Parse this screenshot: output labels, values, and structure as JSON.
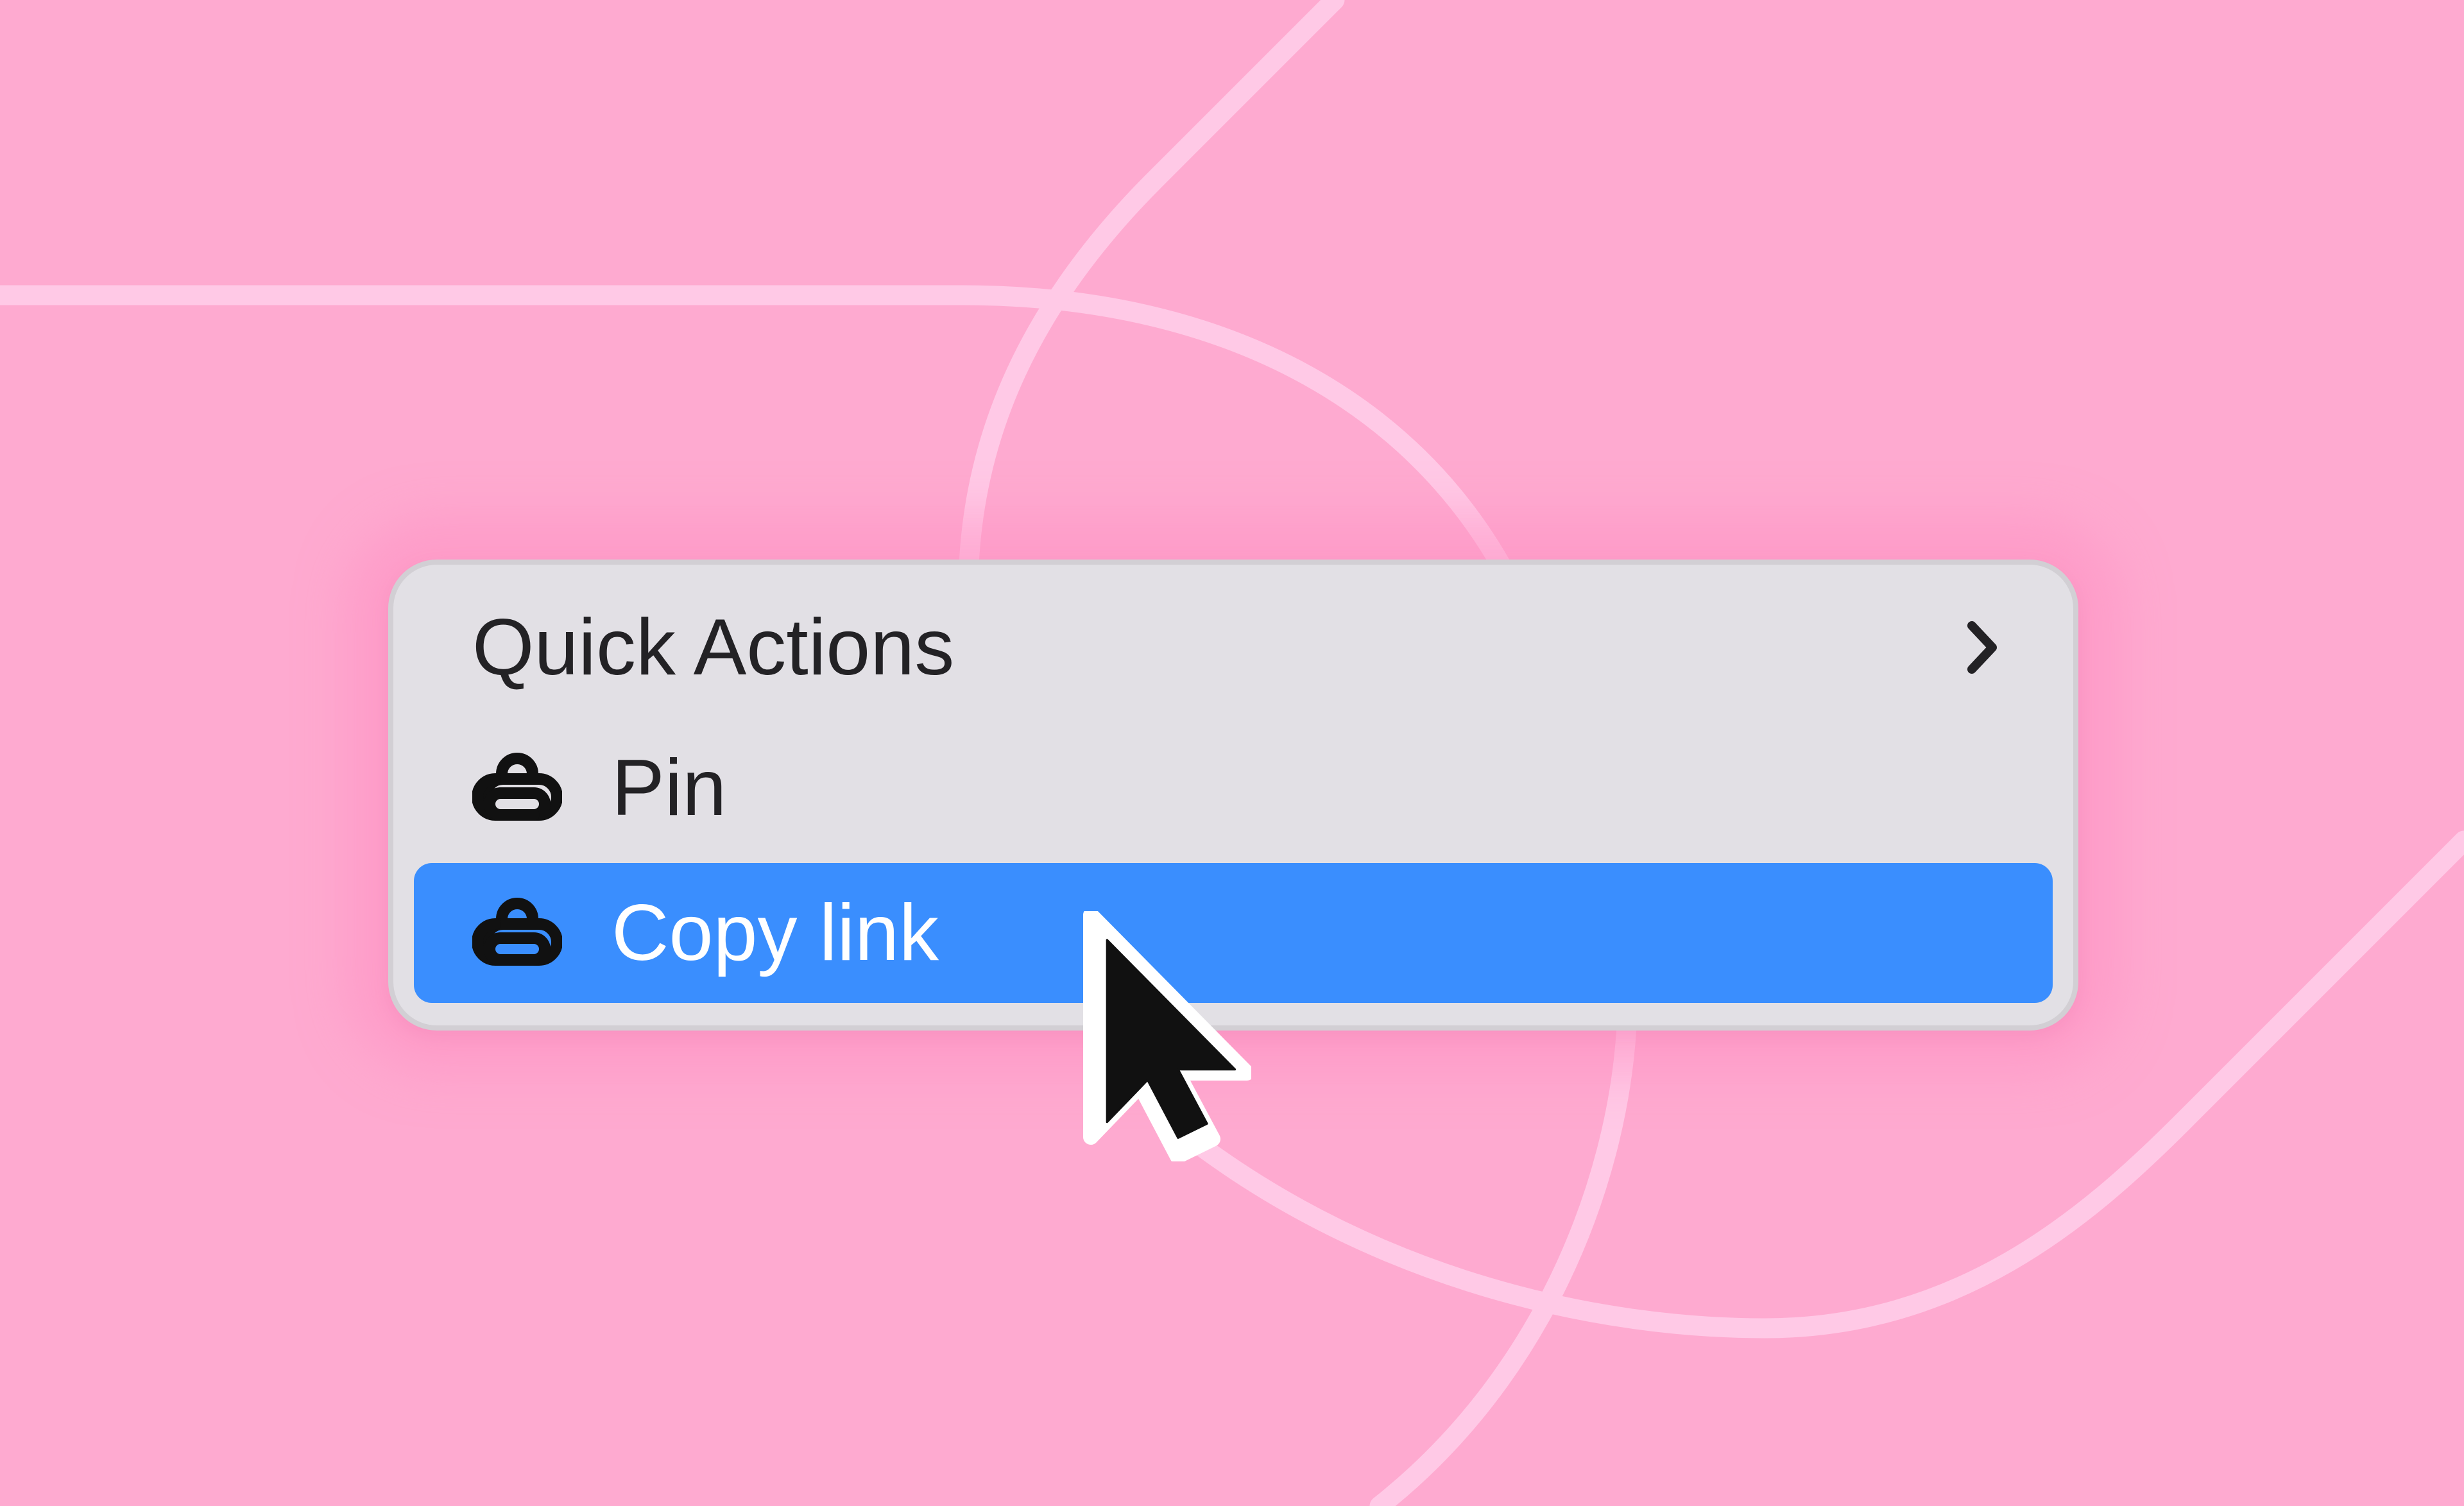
{
  "context_menu": {
    "items": [
      {
        "label": "Quick Actions",
        "icon": "chevron-right-icon",
        "has_submenu": true,
        "highlighted": false
      },
      {
        "label": "Pin",
        "icon": "linked-rings-icon",
        "has_submenu": false,
        "highlighted": false
      },
      {
        "label": "Copy link",
        "icon": "linked-rings-icon",
        "has_submenu": false,
        "highlighted": true
      }
    ]
  },
  "colors": {
    "background": "#FEAAD0",
    "background_lines": "#FFC9E6",
    "menu_background": "#E2E0E5",
    "menu_border": "#D2CFD4",
    "highlight": "#3A8EFE",
    "text": "#232225",
    "highlight_text": "#FFFFFF"
  },
  "cursor": {
    "icon": "arrow-pointer-icon"
  }
}
